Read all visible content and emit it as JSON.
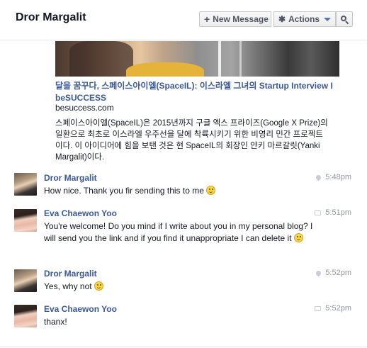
{
  "header": {
    "title": "Dror Margalit",
    "new_message_label": "New Message",
    "actions_label": "Actions",
    "icons": [
      "plus-icon",
      "gear-icon",
      "chevron-down-icon",
      "search-icon"
    ]
  },
  "shared_link": {
    "title": "달을 꿈꾸다, 스페이스아이엘(SpaceIL): 이스라엘 그녀의 Startup Interview I beSUCCESS",
    "domain": "besuccess.com",
    "description": "스페이스아이엘(SpaceIL)은 2015년까지 구글 엑스 프라이즈(Google X Prize)의 일환으로 최초로 이스라엘 우주선을 달에 착륙시키기 위한 비영리 민간 프로젝트이다. 이 아이디어에 힘을 보탠 것은 현 SpaceIL의 회장인 얀키 마르갈릿(Yanki Margalit)이다."
  },
  "messages": [
    {
      "sender": "Dror Margalit",
      "text": "How nice. Thank you fir sending this to me",
      "time": "5:48pm",
      "source_icon": "location-pin-icon",
      "emoji": true
    },
    {
      "sender": "Eva Chaewon Yoo",
      "text": "You're welcome! Do you mind if I write about you in my personal blog? I will send you the link and if you find it unappropriate I can delete it",
      "time": "5:51pm",
      "source_icon": "chat-bubble-icon",
      "emoji": true
    },
    {
      "sender": "Dror Margalit",
      "text": "Yes, why not",
      "time": "5:52pm",
      "source_icon": "location-pin-icon",
      "emoji": true
    },
    {
      "sender": "Eva Chaewon Yoo",
      "text": "thanx!",
      "time": "5:52pm",
      "source_icon": "chat-bubble-icon",
      "emoji": false
    }
  ],
  "colors": {
    "link_blue": "#3b5998",
    "text": "#141823",
    "meta_gray": "#9197a3"
  }
}
